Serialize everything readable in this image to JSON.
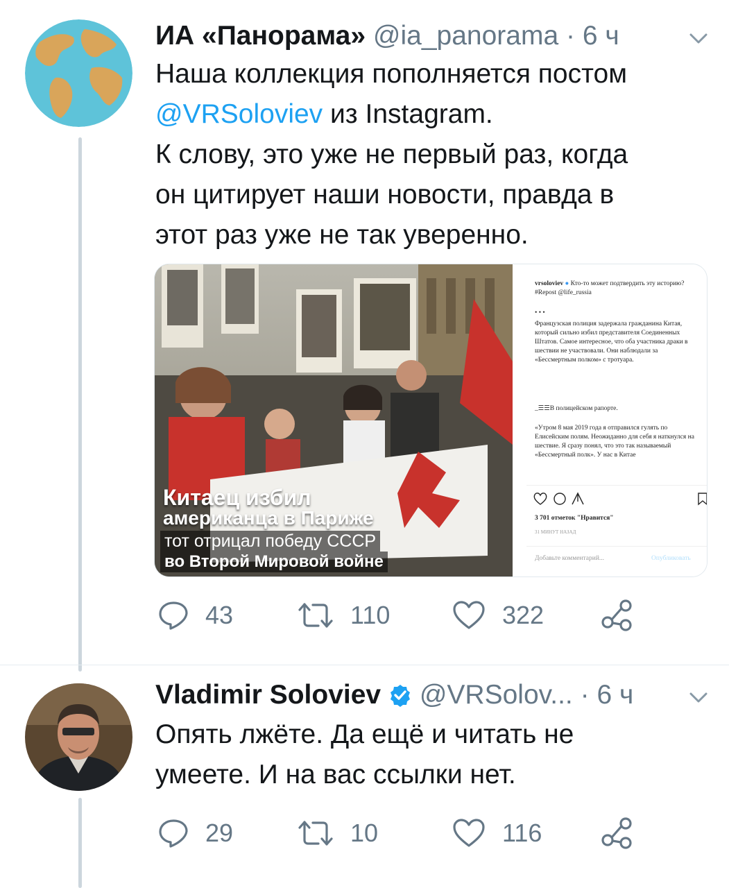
{
  "colors": {
    "accent": "#1da1f2",
    "muted": "#657786",
    "text": "#14171a",
    "verified": "#1da1f2"
  },
  "tweet1": {
    "author_name": "ИА «Панорама»",
    "handle": "@ia_panorama",
    "separator": "·",
    "time": "6 ч",
    "text_line1": "Наша коллекция пополняется постом",
    "mention": "@VRSoloviev",
    "text_line2_rest": " из Instagram.",
    "text_line3": "К слову, это уже не первый раз, когда",
    "text_line4": "он цитирует наши новости, правда в",
    "text_line5": "этот раз уже не так уверенно.",
    "media": {
      "overlay_line1": "Китаец избил",
      "overlay_line2": "американца в Париже",
      "overlay_line3": "тот отрицал победу СССР",
      "overlay_line4": "во Второй Мировой войне",
      "insta": {
        "username": "vrsoloviev",
        "caption": "Кто-то может подтвердить эту историю? #Repost @life_russia",
        "dots": "• • •",
        "para1": "Французская полиция задержала гражданина Китая, который сильно избил представителя Соединенных Штатов. Самое интересное, что оба участника драки в шествии не участвовали. Они наблюдали за «Бессмертным полком» с тротуара.",
        "para2": "_☰☰В полицейском рапорте.",
        "para3": "«Утром 8 мая 2019 года я отправился гулять по Елисейским полям. Неожиданно для себя я наткнулся на шествие. Я сразу понял, что это так называемый «Бессмертный полк». У нас в Китае",
        "likes": "3 701 отметок \"Нравится\"",
        "time_ago": "31 МИНУТ НАЗАД",
        "comment_placeholder": "Добавьте комментарий...",
        "publish": "Опубликовать"
      }
    },
    "replies": "43",
    "retweets": "110",
    "likes": "322"
  },
  "tweet2": {
    "author_name": "Vladimir Soloviev",
    "handle": "@VRSolov...",
    "separator": "·",
    "time": "6 ч",
    "text_line1": "Опять лжёте. Да ещё и читать не",
    "text_line2": "умеете. И на вас ссылки нет.",
    "replies": "29",
    "retweets": "10",
    "likes": "116"
  },
  "icons": {
    "avatar1": "globe-avatar",
    "avatar2": "portrait-avatar",
    "reply": "reply-icon",
    "retweet": "retweet-icon",
    "like": "heart-icon",
    "share": "share-icon",
    "more": "chevron-down-icon",
    "verified": "verified-badge-icon"
  }
}
